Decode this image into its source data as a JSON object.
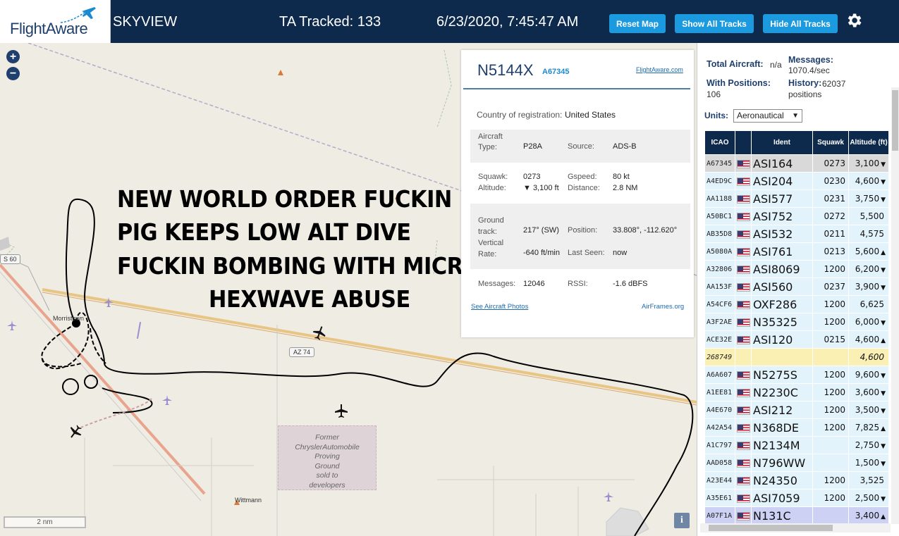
{
  "header": {
    "logo": "FlightAware",
    "app_title": "SKYVIEW",
    "tracked": "TA Tracked: 133",
    "datetime": "6/23/2020, 7:45:47 AM",
    "buttons": {
      "reset": "Reset Map",
      "show": "Show All Tracks",
      "hide": "Hide All Tracks"
    },
    "bg_color": "#0d2a4d",
    "button_color": "#1c9ae0"
  },
  "map": {
    "scale_label": "2 nm",
    "info_label": "i",
    "places": {
      "town1": "Morristown",
      "town2": "Wittmann"
    },
    "route_shields": {
      "az74": "AZ 74",
      "s60": "S 60"
    },
    "chrysler_label": [
      "Former",
      "ChryslerAutomobile",
      "Proving",
      "Ground",
      "sold to",
      "developers"
    ],
    "overlay_text": [
      "NEW WORLD ORDER FUCKIN",
      "PIG KEEPS LOW ALT DIVE",
      "FUCKIN BOMBING WITH MICROWAVE",
      "HEXWAVE ABUSE"
    ]
  },
  "popup": {
    "callsign": "N5144X",
    "hex": "A67345",
    "fa_link": "FlightAware.com",
    "country_label": "Country of registration:",
    "country_value": "United States",
    "aircraft_type_label": "Aircraft Type:",
    "aircraft_type_value": "P28A",
    "source_label": "Source:",
    "source_value": "ADS-B",
    "squawk_label": "Squawk:",
    "squawk_value": "0273",
    "altitude_label": "Altitude:",
    "altitude_value": "▼ 3,100 ft",
    "gspeed_label": "Gspeed:",
    "gspeed_value": "80 kt",
    "distance_label": "Distance:",
    "distance_value": "2.8 NM",
    "ground_track_label": "Ground track:",
    "ground_track_value": "217° (SW)",
    "position_label": "Position:",
    "position_value": "33.808°, -112.620°",
    "vrate_label": "Vertical Rate:",
    "vrate_value": "-640 ft/min",
    "last_seen_label": "Last Seen:",
    "last_seen_value": "now",
    "messages_label": "Messages:",
    "messages_value": "12046",
    "rssi_label": "RSSI:",
    "rssi_value": "-1.6 dBFS",
    "photos_link": "See Aircraft Photos",
    "airframes_link": "AirFrames.org"
  },
  "sidebar": {
    "total_aircraft_label": "Total Aircraft:",
    "total_aircraft_value": "n/a",
    "messages_label": "Messages:",
    "messages_value": "1070.4/sec",
    "with_positions_label": "With Positions:",
    "with_positions_value": "106",
    "history_label": "History:",
    "history_value": "62037 positions",
    "units_label": "Units:",
    "units_value": "Aeronautical",
    "columns": [
      "ICAO",
      "",
      "Ident",
      "Squawk",
      "Altitude (ft)"
    ],
    "rows": [
      {
        "icao": "A67345",
        "ident": "ASI164",
        "squawk": "0273",
        "alt": "3,100",
        "arrow": "▼",
        "state": "sel"
      },
      {
        "icao": "A4ED9C",
        "ident": "ASI204",
        "squawk": "0230",
        "alt": "4,600",
        "arrow": "▼",
        "state": ""
      },
      {
        "icao": "AA1188",
        "ident": "ASI577",
        "squawk": "0231",
        "alt": "3,750",
        "arrow": "▼",
        "state": ""
      },
      {
        "icao": "A50BC1",
        "ident": "ASI752",
        "squawk": "0272",
        "alt": "5,500",
        "arrow": "",
        "state": ""
      },
      {
        "icao": "AB35D8",
        "ident": "ASI532",
        "squawk": "0211",
        "alt": "4,575",
        "arrow": "",
        "state": ""
      },
      {
        "icao": "A5080A",
        "ident": "ASI761",
        "squawk": "0213",
        "alt": "5,600",
        "arrow": "▲",
        "state": ""
      },
      {
        "icao": "A32806",
        "ident": "ASI8069",
        "squawk": "1200",
        "alt": "6,200",
        "arrow": "▼",
        "state": ""
      },
      {
        "icao": "AA153F",
        "ident": "ASI560",
        "squawk": "0237",
        "alt": "3,900",
        "arrow": "▼",
        "state": ""
      },
      {
        "icao": "A54CF6",
        "ident": "OXF286",
        "squawk": "1200",
        "alt": "6,625",
        "arrow": "",
        "state": ""
      },
      {
        "icao": "A3F2AE",
        "ident": "N35325",
        "squawk": "1200",
        "alt": "6,000",
        "arrow": "▼",
        "state": ""
      },
      {
        "icao": "ACE32E",
        "ident": "ASI120",
        "squawk": "0215",
        "alt": "4,600",
        "arrow": "▲",
        "state": ""
      },
      {
        "icao": "268749",
        "ident": "",
        "squawk": "",
        "alt": "4,600",
        "arrow": "",
        "state": "mlat"
      },
      {
        "icao": "A6A607",
        "ident": "N5275S",
        "squawk": "1200",
        "alt": "9,600",
        "arrow": "▼",
        "state": ""
      },
      {
        "icao": "A1EE81",
        "ident": "N2230C",
        "squawk": "1200",
        "alt": "3,600",
        "arrow": "▼",
        "state": ""
      },
      {
        "icao": "A4E670",
        "ident": "ASI212",
        "squawk": "1200",
        "alt": "3,500",
        "arrow": "▼",
        "state": ""
      },
      {
        "icao": "A42A54",
        "ident": "N368DE",
        "squawk": "1200",
        "alt": "7,825",
        "arrow": "▲",
        "state": ""
      },
      {
        "icao": "A1C797",
        "ident": "N2134M",
        "squawk": "",
        "alt": "2,750",
        "arrow": "▼",
        "state": ""
      },
      {
        "icao": "AAD058",
        "ident": "N796WW",
        "squawk": "",
        "alt": "1,500",
        "arrow": "▼",
        "state": ""
      },
      {
        "icao": "A23E44",
        "ident": "N24350",
        "squawk": "1200",
        "alt": "3,525",
        "arrow": "",
        "state": ""
      },
      {
        "icao": "A35E61",
        "ident": "ASI7059",
        "squawk": "1200",
        "alt": "2,500",
        "arrow": "▼",
        "state": ""
      },
      {
        "icao": "A07F1A",
        "ident": "N131C",
        "squawk": "",
        "alt": "3,400",
        "arrow": "▲",
        "state": "hl"
      }
    ]
  }
}
